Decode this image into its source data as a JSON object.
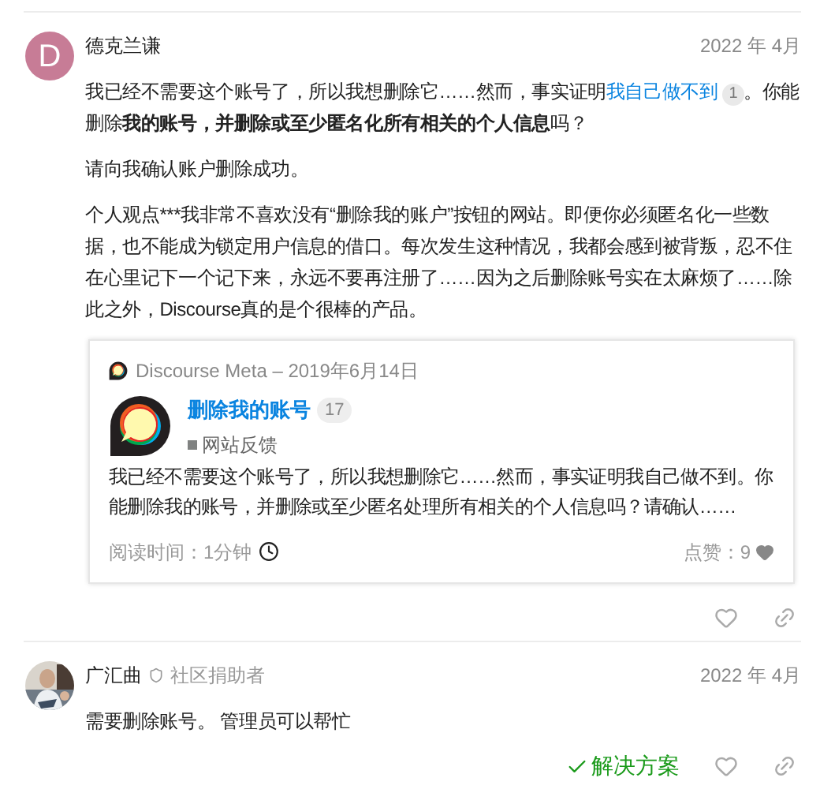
{
  "posts": [
    {
      "avatar": {
        "kind": "letter",
        "letter": "D",
        "color": "#c77c96"
      },
      "author": "德克兰谦",
      "date": "2022 年 4月",
      "paragraphs": [
        [
          {
            "kind": "text",
            "text": "我已经不需要这个账号了，所以我想删除它……然而，事实证明"
          },
          {
            "kind": "link",
            "text": "我自己做不到",
            "badge": "1"
          },
          {
            "kind": "text",
            "text": "。你能删除**我的账号，并删除或至少匿名化所有相关的个人信息**吗？"
          }
        ],
        [
          {
            "kind": "text",
            "text": "请向我确认账户删除成功。"
          }
        ],
        [
          {
            "kind": "text",
            "text": "个人观点***我非常不喜欢没有“删除我的账户”按钮的网站。即便你必须匿名化一些数据，也不能成为锁定用户信息的借口。每次发生这种情况，我都会感到被背叛，忍不住在心里记下一个记下来，永远不要再注册了……因为之后删除账号实在太麻烦了……除此之外，Discourse真的是个很棒的产品。"
          }
        ]
      ],
      "quote": {
        "source": "Discourse Meta – 2019年6月14日",
        "title": "删除我的账号",
        "count": "17",
        "category": {
          "name": "网站反馈",
          "color": "#808281"
        },
        "excerpt": "我已经不需要这个账号了，所以我想删除它……然而，事实证明我自己做不到。你能删除我的账号，并删除或至少匿名处理所有相关的个人信息吗？请确认……",
        "read_time": "阅读时间：1分钟",
        "likes": "点赞：9"
      }
    },
    {
      "avatar": {
        "kind": "picture"
      },
      "author": "广汇曲",
      "role": "社区捐助者",
      "date": "2022 年 4月",
      "paragraphs": [
        [
          {
            "kind": "text",
            "text": "需要删除账号。 管理员可以帮忙"
          }
        ]
      ],
      "solution": "解决方案"
    }
  ]
}
